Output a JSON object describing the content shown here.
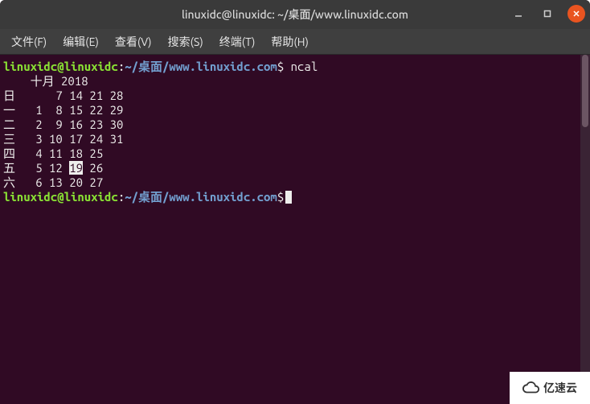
{
  "titlebar": {
    "title": "linuxidc@linuxidc: ~/桌面/www.linuxidc.com"
  },
  "menubar": {
    "items": [
      {
        "label": "文件(F)"
      },
      {
        "label": "编辑(E)"
      },
      {
        "label": "查看(V)"
      },
      {
        "label": "搜索(S)"
      },
      {
        "label": "终端(T)"
      },
      {
        "label": "帮助(H)"
      }
    ]
  },
  "prompt": {
    "user": "linuxidc",
    "at": "@",
    "host": "linuxidc",
    "colon": ":",
    "path": "~/桌面/www.linuxidc.com",
    "dollar": "$"
  },
  "command1": " ncal",
  "calendar": {
    "header": "    十月 2018",
    "rows": [
      {
        "day": "日",
        "cells": "      7 14 21 28"
      },
      {
        "day": "一",
        "cells": "   1  8 15 22 29"
      },
      {
        "day": "二",
        "cells": "   2  9 16 23 30"
      },
      {
        "day": "三",
        "cells": "   3 10 17 24 31"
      },
      {
        "day": "四",
        "cells": "   4 11 18 25"
      },
      {
        "day": "五",
        "before": "   5 12 ",
        "today": "19",
        "after": " 26"
      },
      {
        "day": "六",
        "cells": "   6 13 20 27"
      }
    ]
  },
  "watermark": {
    "text": "亿速云"
  }
}
